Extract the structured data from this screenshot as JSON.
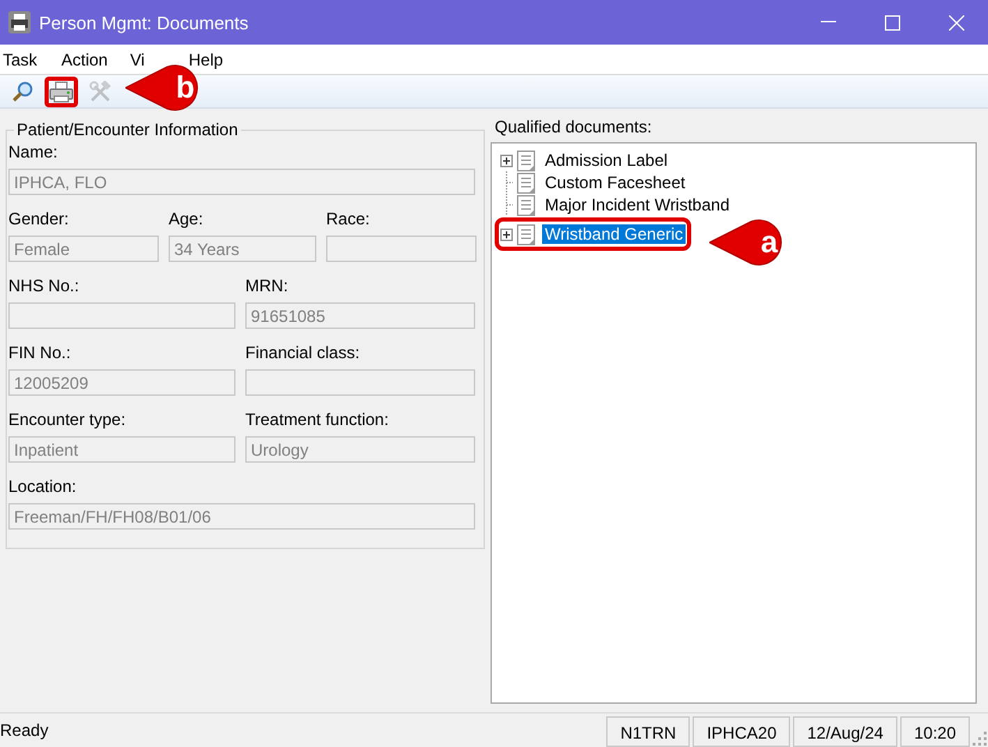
{
  "window": {
    "title": "Person Mgmt: Documents"
  },
  "menu": [
    "Task",
    "Action",
    "Vi",
    "Help"
  ],
  "toolbar": [
    {
      "kind": "search",
      "disabled": false,
      "highlighted": false
    },
    {
      "kind": "print",
      "disabled": false,
      "highlighted": true,
      "callout": "b"
    },
    {
      "kind": "tools",
      "disabled": true,
      "highlighted": false
    }
  ],
  "patient_panel": {
    "title": "Patient/Encounter Information",
    "rows": [
      [
        {
          "label": "Name:",
          "value": "IPHCA, FLO"
        }
      ],
      [
        {
          "label": "Gender:",
          "value": "Female"
        },
        {
          "label": "Age:",
          "value": "34 Years"
        },
        {
          "label": "Race:"
        }
      ],
      [
        {
          "label": "NHS No.:"
        },
        {
          "label": "MRN:",
          "value": "91651085"
        }
      ],
      [
        {
          "label": "FIN No.:",
          "value": "12005209"
        },
        {
          "label": "Financial class:"
        }
      ],
      [
        {
          "label": "Encounter type:",
          "value": "Inpatient"
        },
        {
          "label": "Treatment function:",
          "value": "Urology"
        }
      ],
      [
        {
          "label": "Location:",
          "value": "Freeman/FH/FH08/B01/06"
        }
      ]
    ]
  },
  "documents": {
    "label": "Qualified documents:",
    "items": [
      {
        "label": "Admission Label",
        "expandable": true,
        "selected": false,
        "highlighted": false
      },
      {
        "label": "Custom Facesheet",
        "expandable": false,
        "selected": false,
        "highlighted": false
      },
      {
        "label": "Major Incident Wristband",
        "expandable": false,
        "selected": false,
        "highlighted": false
      },
      {
        "label": "Wristband Generic",
        "expandable": true,
        "selected": true,
        "highlighted": true,
        "callout": "a"
      }
    ]
  },
  "status_bar": {
    "message": "Ready",
    "panels": [
      "N1TRN",
      "IPHCA20",
      "12/Aug/24",
      "10:20"
    ]
  }
}
